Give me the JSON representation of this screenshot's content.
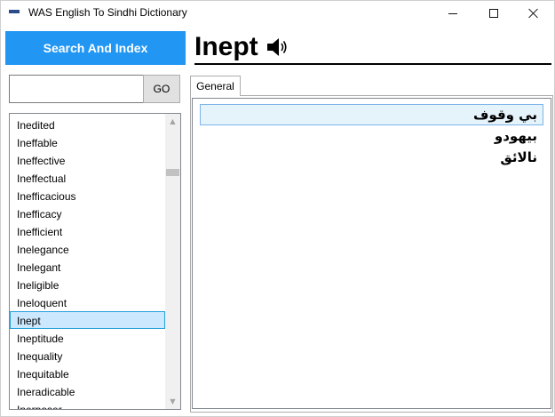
{
  "window": {
    "title": "WAS English To Sindhi Dictionary",
    "controls": {
      "minimize": "minimize",
      "maximize": "maximize",
      "close": "close"
    }
  },
  "app_icon": {
    "label_row1": "ABC",
    "label_row2": "ڀ ڏ"
  },
  "sidebar": {
    "header": "Search And Index",
    "search": {
      "value": "",
      "placeholder": ""
    },
    "go_label": "GO",
    "words": [
      "Inedited",
      "Ineffable",
      "Ineffective",
      "Ineffectual",
      "Inefficacious",
      "Inefficacy",
      "Inefficient",
      "Inelegance",
      "Inelegant",
      "Ineligible",
      "Ineloquent",
      "Inept",
      "Ineptitude",
      "Inequality",
      "Inequitable",
      "Ineradicable",
      "Inerposer"
    ],
    "selected_word": "Inept"
  },
  "main": {
    "word": "Inept",
    "tabs": [
      {
        "label": "General",
        "active": true
      }
    ],
    "meanings": [
      "بي وقوف",
      "بيهودو",
      "نالائق"
    ],
    "selected_meaning_index": 0
  },
  "colors": {
    "accent": "#2196f3",
    "selection": "#cce8ff",
    "selection_border": "#26a0da"
  }
}
